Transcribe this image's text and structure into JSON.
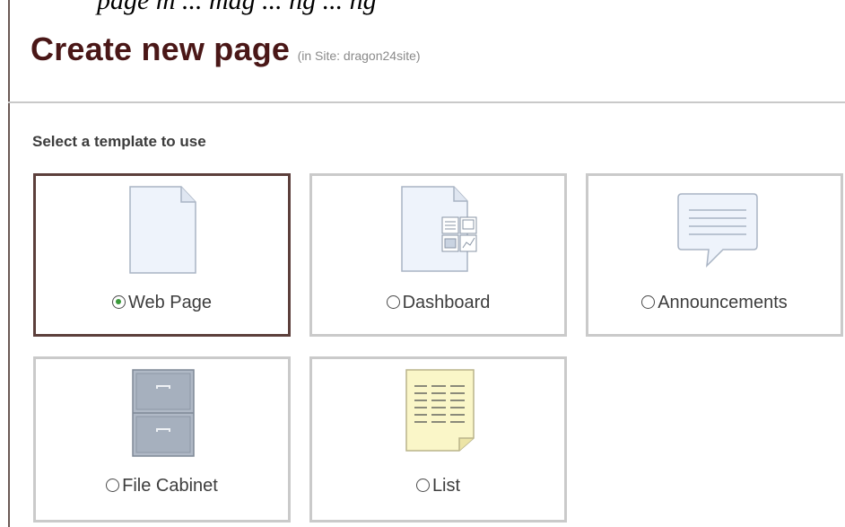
{
  "header": {
    "cropped_text": "page m ... mag ... ng ... ng",
    "title": "Create new page",
    "site_note": "(in Site: dragon24site)"
  },
  "section_label": "Select a template to use",
  "templates": [
    {
      "label": "Web Page",
      "icon": "document-icon",
      "selected": true
    },
    {
      "label": "Dashboard",
      "icon": "dashboard-icon",
      "selected": false
    },
    {
      "label": "Announcements",
      "icon": "speech-bubble-icon",
      "selected": false
    },
    {
      "label": "File Cabinet",
      "icon": "file-cabinet-icon",
      "selected": false
    },
    {
      "label": "List",
      "icon": "list-icon",
      "selected": false
    }
  ],
  "colors": {
    "title": "#4a1717",
    "selected_border": "#5c3f3b",
    "card_border": "#cacaca",
    "radio_check": "#3a9a3a"
  }
}
